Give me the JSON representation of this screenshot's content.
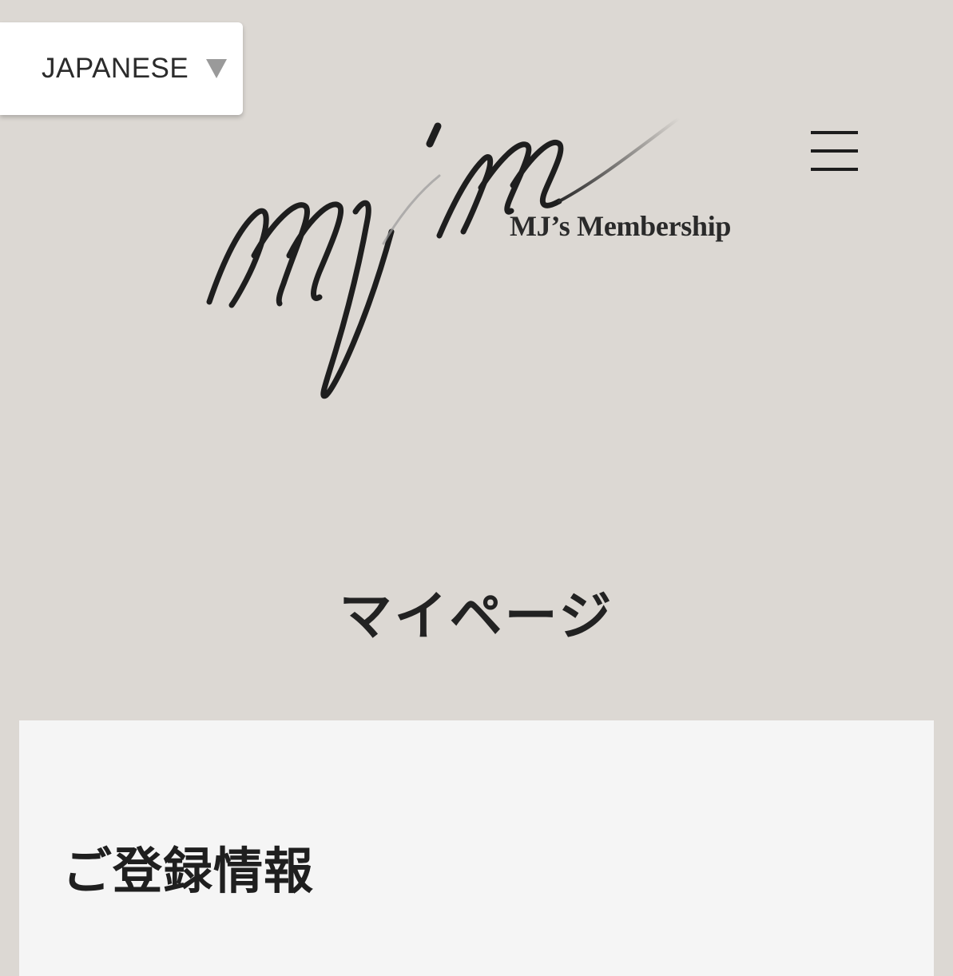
{
  "header": {
    "language_selector": {
      "selected": "JAPANESE",
      "icon": "caret-down-icon"
    },
    "logo": {
      "monogram": "mjm",
      "wordmark": "MJ’s Membership"
    },
    "menu_icon": "hamburger-menu-icon"
  },
  "main": {
    "page_title": "マイページ",
    "registration_card": {
      "title": "ご登録情報"
    }
  },
  "colors": {
    "page_background": "#dcd8d3",
    "card_background": "#f5f5f5",
    "text": "#222222"
  }
}
